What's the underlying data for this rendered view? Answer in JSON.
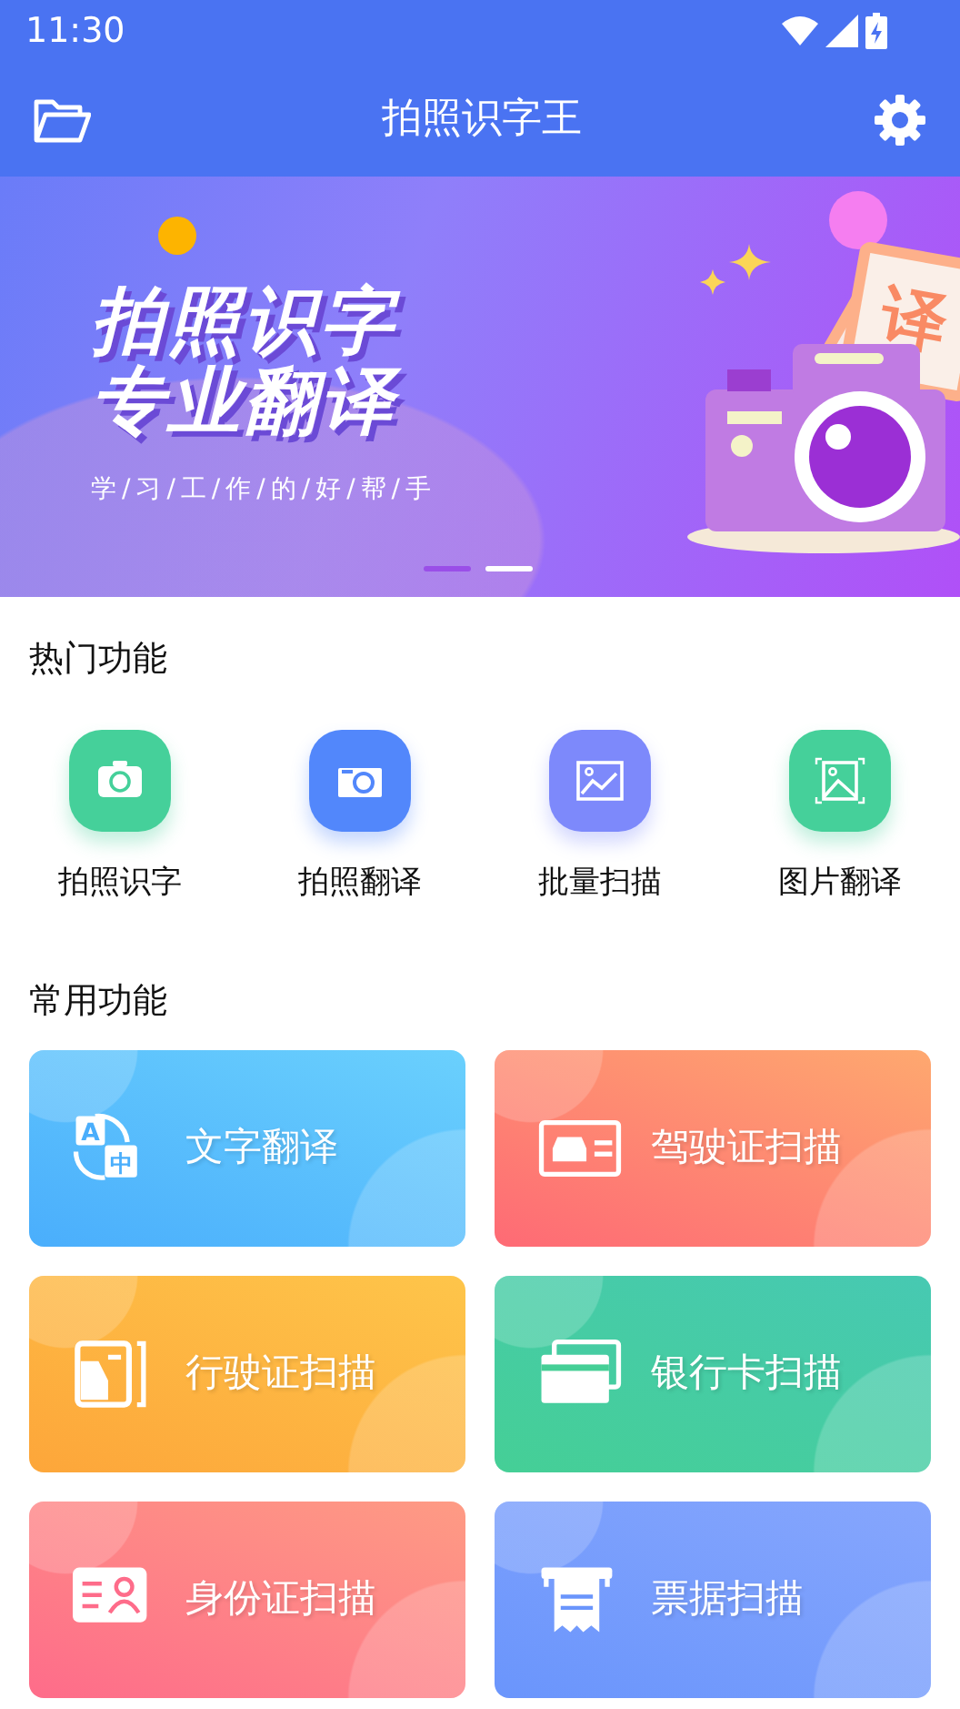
{
  "status_bar": {
    "time": "11:30"
  },
  "app_bar": {
    "title": "拍照识字王"
  },
  "banner": {
    "headline_1": "拍照识字",
    "headline_2": "专业翻译",
    "tagline": "学/习/工/作/的/好/帮/手",
    "badge_char": "译",
    "slides": [
      {
        "selected": true
      },
      {
        "selected": false
      }
    ]
  },
  "hot_section": {
    "title": "热门功能",
    "items": [
      {
        "label": "拍照识字",
        "kind": "camera",
        "color": "#45d09a"
      },
      {
        "label": "拍照翻译",
        "kind": "camera2",
        "color": "#5287fb"
      },
      {
        "label": "批量扫描",
        "kind": "picture",
        "color": "#7d89fb"
      },
      {
        "label": "图片翻译",
        "kind": "scan",
        "color": "#45d09a"
      }
    ]
  },
  "common_section": {
    "title": "常用功能",
    "cards": [
      {
        "label": "文字翻译",
        "kind": "translate",
        "color": "#4aaefc",
        "icon_glyphs": [
          "A",
          "中"
        ]
      },
      {
        "label": "驾驶证扫描",
        "kind": "license",
        "color": "#fe6a75"
      },
      {
        "label": "行驶证扫描",
        "kind": "vehicle",
        "color": "#fda63a"
      },
      {
        "label": "银行卡扫描",
        "kind": "bankcard",
        "color": "#45cf96"
      },
      {
        "label": "身份证扫描",
        "kind": "idcard",
        "color": "#fe6c8a"
      },
      {
        "label": "票据扫描",
        "kind": "receipt",
        "color": "#6a95fc"
      }
    ]
  }
}
